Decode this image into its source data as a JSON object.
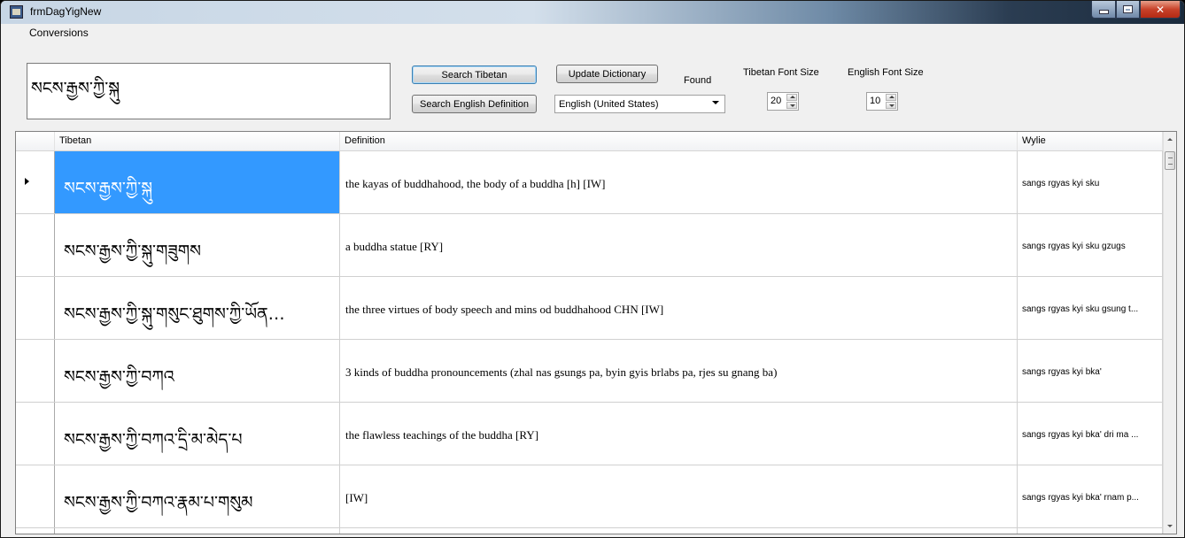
{
  "window": {
    "title": "frmDagYigNew"
  },
  "menu": {
    "items": [
      "Conversions"
    ]
  },
  "search": {
    "value": "སངས་རྒྱས་ཀྱི་སྐུ"
  },
  "toolbar": {
    "search_tibetan": "Search Tibetan",
    "search_english": "Search English Definition",
    "update_dictionary": "Update Dictionary",
    "found_label": "Found",
    "language_selected": "English (United States)",
    "tibetan_font_size_label": "Tibetan Font Size",
    "tibetan_font_size": "20",
    "english_font_size_label": "English Font Size",
    "english_font_size": "10"
  },
  "grid": {
    "columns": [
      "Tibetan",
      "Definition",
      "Wylie"
    ],
    "rows": [
      {
        "tibetan": "སངས་རྒྱས་ཀྱི་སྐུ",
        "definition": "the kayas of buddhahood, the body of a buddha [h] [IW]",
        "wylie": "sangs rgyas kyi sku",
        "selected": true
      },
      {
        "tibetan": "སངས་རྒྱས་ཀྱི་སྐུ་གཟུགས",
        "definition": "a buddha statue [RY]",
        "wylie": "sangs rgyas kyi sku gzugs"
      },
      {
        "tibetan": "སངས་རྒྱས་ཀྱི་སྐུ་གསུང་ཐུགས་ཀྱི་ཡོན…",
        "definition": "the three virtues of body speech and mins od buddhahood CHN [IW]",
        "wylie": "sangs rgyas kyi sku gsung t..."
      },
      {
        "tibetan": "སངས་རྒྱས་ཀྱི་བཀའ",
        "definition": "3 kinds of buddha pronouncements (zhal nas gsungs pa, byin gyis brlabs pa, rjes su gnang ba)",
        "wylie": "sangs rgyas kyi bka'"
      },
      {
        "tibetan": "སངས་རྒྱས་ཀྱི་བཀའ་དྲི་མ་མེད་པ",
        "definition": "the flawless teachings of the buddha [RY]",
        "wylie": "sangs rgyas kyi bka' dri ma ..."
      },
      {
        "tibetan": "སངས་རྒྱས་ཀྱི་བཀའ་རྣམ་པ་གསུམ",
        "definition": "[IW]",
        "wylie": "sangs rgyas kyi bka' rnam p..."
      }
    ]
  },
  "colors": {
    "selection": "#3399ff"
  }
}
